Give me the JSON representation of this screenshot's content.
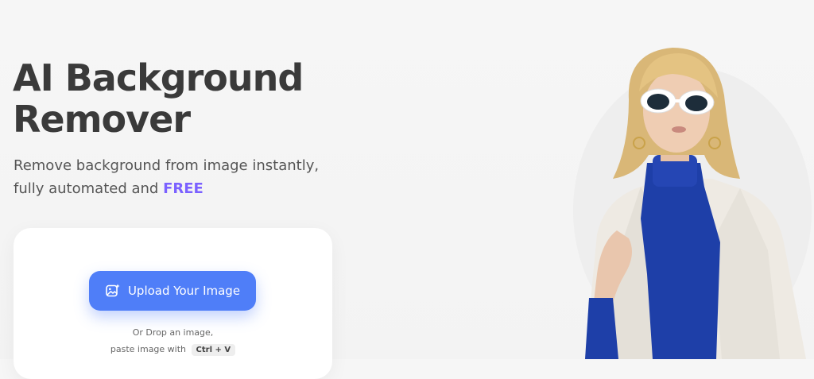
{
  "hero": {
    "title_line1": "AI Background",
    "title_line2": "Remover",
    "subtitle_line1": "Remove background from image instantly,",
    "subtitle_line2_prefix": "fully automated and ",
    "subtitle_highlight": "FREE"
  },
  "upload": {
    "button_label": "Upload Your Image",
    "button_icon": "image-sparkle-icon",
    "drop_hint": "Or Drop an image,",
    "paste_hint": "paste image with",
    "shortcut": "Ctrl + V"
  },
  "colors": {
    "accent_button": "#4f7ef8",
    "highlight": "#7b61ff",
    "title": "#3a3a3a"
  },
  "illustration": {
    "subject": "woman-with-white-sunglasses"
  }
}
